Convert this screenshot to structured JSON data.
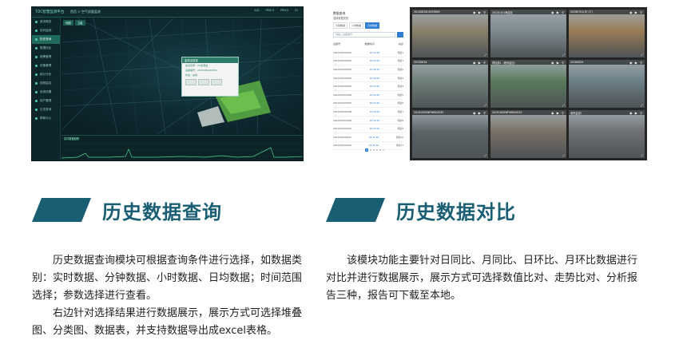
{
  "left_screenshot": {
    "logo": "TOC智慧监测平台",
    "breadcrumb": "首页 > 空气质量监测",
    "stats": [
      "AQI",
      "PM2.5",
      "PM10",
      "O₃"
    ],
    "sidebar": [
      "首页概览",
      "实时监测",
      "历史查询",
      "数据对比",
      "报警管理",
      "设备管理",
      "统计分析",
      "视频监控",
      "系统设置",
      "用户管理",
      "日志查询",
      "帮助中心"
    ],
    "map_tabs": [
      "地图",
      "卫星"
    ],
    "popup": {
      "header": "监测点信息",
      "lines": [
        "站点名称：XX监测站",
        "设备编号：2021030100001",
        "状态：在线"
      ]
    },
    "chart_title": "实时数据趋势"
  },
  "right_screenshot": {
    "title": "数据查询",
    "subtitle": "选择数据类型",
    "tabs": [
      "分钟数据",
      "小时数据",
      "日均数据"
    ],
    "active_tab": 2,
    "search_placeholder": "请输入设备编号",
    "headers": [
      "设备号",
      "数据时间",
      "站点"
    ],
    "rows": [
      [
        "2021030100001",
        "18:52:30",
        "测试1"
      ],
      [
        "2021030100002",
        "18:50:20",
        "测试1"
      ],
      [
        "2021030100003",
        "18:48:10",
        "测试2"
      ],
      [
        "2021030100004",
        "18:46:00",
        "测试3"
      ],
      [
        "2021030100005",
        "18:44:50",
        "测试4"
      ],
      [
        "2021030100006",
        "18:42:40",
        "测试5"
      ],
      [
        "2021030100007",
        "18:40:30",
        "测试6"
      ],
      [
        "2021030100008",
        "18:38:20",
        "测试7"
      ],
      [
        "2021030100009",
        "18:36:10",
        "测试8"
      ],
      [
        "2021030100010",
        "18:34:00",
        "测试9"
      ],
      [
        "2021030100011",
        "18:32:50",
        "测试10"
      ],
      [
        "2021030100012",
        "18:30:40",
        "测试11"
      ]
    ],
    "pager": [
      "1",
      "2",
      "3",
      "4",
      "5",
      ">"
    ],
    "cameras": [
      {
        "label": "20140816C4933663",
        "tone": "#8a7f6a"
      },
      {
        "label": "20150101海淀区",
        "tone": "#7e8a8f"
      },
      {
        "label": "20160701(3F-17)",
        "tone": "#9a7c55"
      },
      {
        "label": "20150816",
        "tone": "#6f7f79"
      },
      {
        "label": "项目部1（塔吊监控）",
        "tone": "#5a7a5a"
      },
      {
        "label": "20160826",
        "tone": "#6b7e86"
      },
      {
        "label": "20191000WF96000032",
        "tone": "#5c6468"
      },
      {
        "label": "20191000WF96000033",
        "tone": "#7a7064"
      },
      {
        "label": "塔吊监控1",
        "tone": "#6e7174"
      }
    ]
  },
  "section_left": {
    "title": "历史数据查询",
    "paragraphs": [
      "历史数据查询模块可根据查询条件进行选择，如数据类别：实时数据、分钟数据、小时数据、日均数据；时间范围选择；参数选择进行查看。",
      "右边针对选择结果进行数据展示，展示方式可选择堆叠图、分类图、数据表，并支持数据导出成excel表格。"
    ]
  },
  "section_right": {
    "title": "历史数据对比",
    "paragraphs": [
      "该模块功能主要针对日同比、月同比、日环比、月环比数据进行对比并进行数据展示，展示方式可选择数值比对、走势比对、分析报告三种，报告可下载至本地。"
    ]
  },
  "colors": {
    "accent": "#1a5e74",
    "dashboard_bg": "#0b1f24",
    "link_blue": "#2f7fd4"
  }
}
